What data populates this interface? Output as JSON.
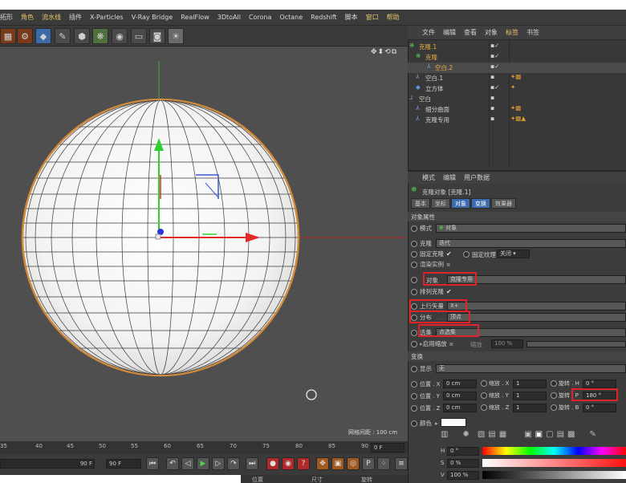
{
  "menubar": {
    "items": [
      "拓形",
      "角色",
      "流水线",
      "插件",
      "X-Particles",
      "V-Ray Bridge",
      "RealFlow",
      "3DtoAll",
      "Corona",
      "Octane",
      "Redshift",
      "脚本",
      "窗口",
      "帮助"
    ]
  },
  "viewport": {
    "grid_distance": "网格间距 : 100 cm",
    "nav_icons": "✥⬍⟲⧉"
  },
  "timeline": {
    "ticks": [
      "35",
      "40",
      "45",
      "50",
      "55",
      "60",
      "65",
      "70",
      "75",
      "80",
      "85",
      "90"
    ],
    "current_frame": "0 F",
    "end_frame_a": "90 F",
    "end_frame_b": "90 F"
  },
  "bottom_bar": {
    "position": "位置",
    "size": "尺寸",
    "rotation": "旋转"
  },
  "object_manager": {
    "menu": [
      "文件",
      "编辑",
      "查看",
      "对象",
      "标签",
      "书签"
    ],
    "highlighted_menu": "标签",
    "objects": [
      {
        "name": "克隆.1",
        "selected": true
      },
      {
        "name": "克隆",
        "selected": true
      },
      {
        "name": "空白.2",
        "selected": true
      },
      {
        "name": "空白.1",
        "selected": false
      },
      {
        "name": "立方体",
        "selected": false
      },
      {
        "name": "空白",
        "selected": false
      },
      {
        "name": "细分曲面",
        "selected": false
      },
      {
        "name": "克隆专用",
        "selected": false
      }
    ]
  },
  "attribute_manager": {
    "menu": [
      "模式",
      "编辑",
      "用户数据"
    ],
    "object_title": "克隆对象 [克隆.1]",
    "tabs": [
      "基本",
      "坐标",
      "对象",
      "变换",
      "效果器"
    ],
    "active_tab": "对象",
    "section_object": "对象属性",
    "mode_label": "模式",
    "mode_value": "对象",
    "clones_label": "克隆",
    "clones_value": "迭代",
    "fixed_clone_label": "固定克隆",
    "fixed_texture_label": "固定纹理",
    "fixed_texture_value": "关闭",
    "render_instances_label": "渲染实例",
    "object_label": "对象",
    "object_value": "克隆专用",
    "arrange_label": "排列克隆",
    "up_vector_label": "上行矢量",
    "up_vector_value": "X+",
    "distribution_label": "分布",
    "distribution_value": "顶点",
    "selection_label": "选集",
    "selection_value": "点选集",
    "enable_scale_label": "启用缩放",
    "scale_label": "缩放",
    "scale_value": "100 %",
    "section_transform": "变换",
    "display_label": "显示",
    "display_value": "无",
    "coords": [
      {
        "pos_label": "位置 . X",
        "pos": "0 cm",
        "scale_label": "缩放 . X",
        "scale": "1",
        "rot_label": "旋转 . H",
        "rot": "0 °"
      },
      {
        "pos_label": "位置 . Y",
        "pos": "0 cm",
        "scale_label": "缩放 . Y",
        "scale": "1",
        "rot_label": "旋转 . P",
        "rot": "180 °"
      },
      {
        "pos_label": "位置 . Z",
        "pos": "0 cm",
        "scale_label": "缩放 . Z",
        "scale": "1",
        "rot_label": "旋转 . B",
        "rot": "0 °"
      }
    ],
    "color_label": "颜色",
    "color_value": "#ffffff",
    "hsv": [
      {
        "label": "H",
        "value": "0 °"
      },
      {
        "label": "S",
        "value": "0 %"
      },
      {
        "label": "V",
        "value": "100 %"
      }
    ]
  },
  "colors": {
    "accent_selected": "#e8b040",
    "highlight_box": "#e0232a",
    "active_tab": "#3d6bb0",
    "viewport_bg": "#4f4f4f"
  }
}
